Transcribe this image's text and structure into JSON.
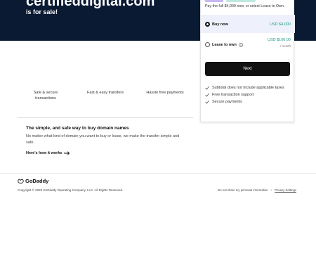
{
  "hero": {
    "domain": "certifieddigital.com",
    "subtitle": "is for sale!"
  },
  "features": [
    {
      "label": "Safe & secure transactions"
    },
    {
      "label": "Fast & easy transfers"
    },
    {
      "label": "Hassle free payments"
    }
  ],
  "info": {
    "title": "The simple, and safe way to buy domain names",
    "text": "No matter what kind of domain you want to buy or lease, we make the transfer simple and safe.",
    "link": "Here's how it works"
  },
  "card": {
    "description": "Pay the full $4,000 now, or select Lease to Own.",
    "options": [
      {
        "label": "Buy now",
        "price": "USD $4,000",
        "selected": true
      },
      {
        "label": "Lease to own",
        "price": "USD $100.00",
        "unit": "/ month",
        "selected": false
      }
    ],
    "next_label": "Next",
    "checks": [
      {
        "label": "Subtotal does not include applicable taxes"
      },
      {
        "label": "Free transaction support"
      },
      {
        "label": "Secure payments"
      }
    ],
    "colors": {
      "price": "#1b9a8a",
      "button": "#111111",
      "selected_bg": "#eef1fb"
    }
  },
  "footer": {
    "logo": "GoDaddy",
    "copyright": "Copyright © 2025 GoDaddy Operating Company, LLC. All Rights Reserved.",
    "do_not_sell": "Do not share my personal information",
    "privacy": "Privacy Settings"
  },
  "colors": {
    "hero_bg": "#0b1a33"
  }
}
